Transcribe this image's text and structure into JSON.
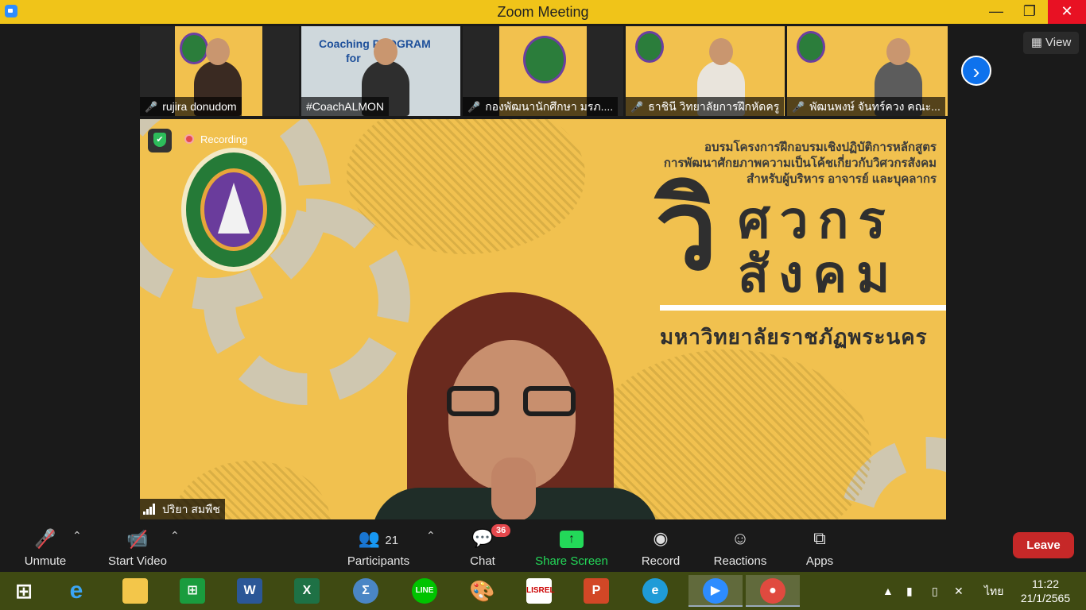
{
  "window": {
    "title": "Zoom Meeting",
    "minimize": "—",
    "maximize": "❐",
    "close": "✕"
  },
  "thumbnails": [
    {
      "name": "rujira donudom",
      "muted": true
    },
    {
      "name": "#CoachALMON",
      "muted": false,
      "slide_text": "Coaching PROGRAM",
      "slide_text2": "for"
    },
    {
      "name": "กองพัฒนานักศึกษา มรภ....",
      "muted": true
    },
    {
      "name": "ธาชินี  วิทยาลัยการฝึกหัดครู",
      "muted": true
    },
    {
      "name": "พัฒนพงษ์ จันทร์ควง คณะ...",
      "muted": true
    }
  ],
  "view_button": {
    "label": "View"
  },
  "main_video": {
    "recording_label": "Recording",
    "slide": {
      "line1": "อบรมโครงการฝึกอบรมเชิงปฏิบัติการหลักสูตร",
      "line2": "การพัฒนาศักยภาพความเป็นโค้ชเกี่ยวกับวิศวกรสังคม",
      "line3": "สำหรับผู้บริหาร อาจารย์ และบุคลากร",
      "big_wi": "วิ",
      "big_line1": "ศวกร",
      "big_line2": "สังคม",
      "university": "มหาวิทยาลัยราชภัฏพระนคร"
    },
    "presenter_name": "ปริยา สมพืช"
  },
  "toolbar": {
    "unmute": "Unmute",
    "start_video": "Start Video",
    "participants": "Participants",
    "participants_count": "21",
    "chat": "Chat",
    "chat_badge": "36",
    "share_screen": "Share Screen",
    "record": "Record",
    "reactions": "Reactions",
    "apps": "Apps",
    "leave": "Leave"
  },
  "taskbar": {
    "language": "ไทย",
    "time": "11:22",
    "date": "21/1/2565",
    "apps": [
      "windows-start",
      "internet-explorer",
      "file-explorer",
      "store",
      "word",
      "excel",
      "math",
      "line",
      "paint",
      "lisrel",
      "powerpoint",
      "edge",
      "zoom",
      "chrome"
    ]
  },
  "colors": {
    "title_bar": "#f0c419",
    "slide_bg": "#f1c14f",
    "accent_blue": "#0e72ed",
    "share_green": "#23d959",
    "leave_red": "#c62828",
    "taskbar": "#3f4a12"
  }
}
